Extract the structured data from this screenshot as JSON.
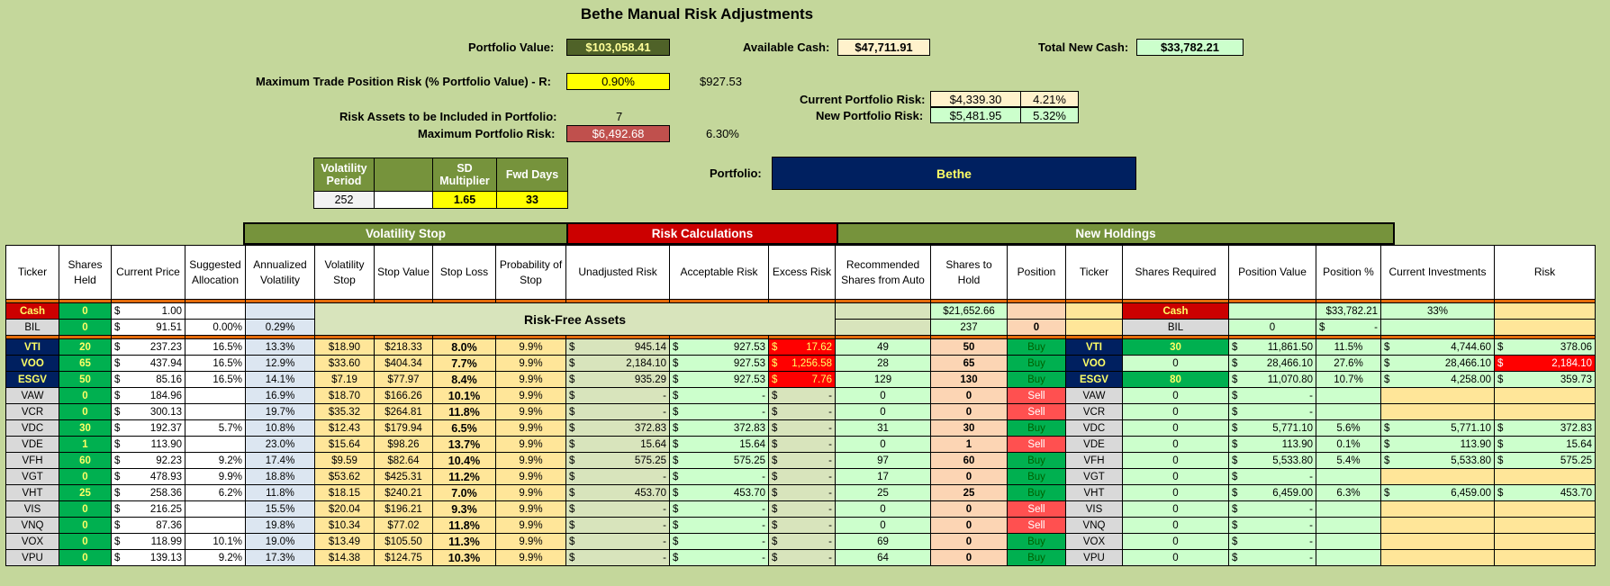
{
  "title": "Bethe Manual Risk Adjustments",
  "top": {
    "portfolio_value_label": "Portfolio Value:",
    "portfolio_value": "$103,058.41",
    "available_cash_label": "Available Cash:",
    "available_cash": "$47,711.91",
    "total_new_cash_label": "Total New Cash:",
    "total_new_cash": "$33,782.21",
    "max_trade_label": "Maximum Trade Position Risk (% Portfolio Value) - R:",
    "max_trade_pct": "0.90%",
    "max_trade_amount": "$927.53",
    "current_risk_label": "Current Portfolio Risk:",
    "current_risk_value": "$4,339.30",
    "current_risk_pct": "4.21%",
    "new_risk_label": "New Portfolio Risk:",
    "new_risk_value": "$5,481.95",
    "new_risk_pct": "5.32%",
    "risk_assets_label": "Risk Assets to be Included in Portfolio:",
    "risk_assets_count": "7",
    "max_portfolio_risk_label": "Maximum Portfolio Risk:",
    "max_portfolio_risk": "$6,492.68",
    "max_portfolio_risk_pct": "6.30%",
    "portfolio_label": "Portfolio:",
    "portfolio_name": "Bethe"
  },
  "params": {
    "h1": "Volatility Period",
    "h2": "",
    "h3": "SD Multiplier",
    "h4": "Fwd Days",
    "v1": "252",
    "v2": "",
    "v3": "1.65",
    "v4": "33"
  },
  "groups": {
    "volatility_stop": "Volatility Stop",
    "risk_calculations": "Risk Calculations",
    "new_holdings": "New Holdings"
  },
  "headers": [
    "Ticker",
    "Shares Held",
    "Current Price",
    "Suggested Allocation",
    "Annualized Volatility",
    "Volatility Stop",
    "Stop Value",
    "Stop Loss",
    "Probability of Stop",
    "Unadjusted Risk",
    "Acceptable Risk",
    "Excess Risk",
    "Recommended Shares from Auto",
    "Shares to Hold",
    "Position",
    "Ticker",
    "Shares Required",
    "Position Value",
    "Position %",
    "Current Investments",
    "Risk"
  ],
  "risk_free_label": "Risk-Free Assets",
  "cash_row": {
    "ticker": "Cash",
    "held": "0",
    "price": "1.00",
    "rec": "$21,652.66",
    "ticker2": "Cash",
    "pos_value": "$33,782.21",
    "pos_pct": "33%"
  },
  "bil_row": {
    "ticker": "BIL",
    "held": "0",
    "price": "91.51",
    "alloc": "0.00%",
    "vol": "0.29%",
    "rec": "237",
    "hold": "0",
    "ticker2": "BIL",
    "req": "0",
    "pos_value": "-"
  },
  "rows": [
    {
      "t": "VTI",
      "held": "20",
      "price": "237.23",
      "alloc": "16.5%",
      "vol": "13.3%",
      "vstop": "$18.90",
      "sval": "$218.33",
      "sloss": "8.0%",
      "prob": "9.9%",
      "unadj": "945.14",
      "acc": "927.53",
      "excess": "17.62",
      "rec": "49",
      "hold": "50",
      "pos": "Buy",
      "req": "30",
      "pval": "11,861.50",
      "ppct": "11.5%",
      "cur": "4,744.60",
      "risk": "378.06"
    },
    {
      "t": "VOO",
      "held": "65",
      "price": "437.94",
      "alloc": "16.5%",
      "vol": "12.9%",
      "vstop": "$33.60",
      "sval": "$404.34",
      "sloss": "7.7%",
      "prob": "9.9%",
      "unadj": "2,184.10",
      "acc": "927.53",
      "excess": "1,256.58",
      "rec": "28",
      "hold": "65",
      "pos": "Buy",
      "req": "0",
      "pval": "28,466.10",
      "ppct": "27.6%",
      "cur": "28,466.10",
      "risk": "2,184.10"
    },
    {
      "t": "ESGV",
      "held": "50",
      "price": "85.16",
      "alloc": "16.5%",
      "vol": "14.1%",
      "vstop": "$7.19",
      "sval": "$77.97",
      "sloss": "8.4%",
      "prob": "9.9%",
      "unadj": "935.29",
      "acc": "927.53",
      "excess": "7.76",
      "rec": "129",
      "hold": "130",
      "pos": "Buy",
      "req": "80",
      "pval": "11,070.80",
      "ppct": "10.7%",
      "cur": "4,258.00",
      "risk": "359.73"
    },
    {
      "t": "VAW",
      "held": "0",
      "price": "184.96",
      "alloc": "",
      "vol": "16.9%",
      "vstop": "$18.70",
      "sval": "$166.26",
      "sloss": "10.1%",
      "prob": "9.9%",
      "unadj": "-",
      "acc": "-",
      "excess": "-",
      "rec": "0",
      "hold": "0",
      "pos": "Sell",
      "req": "0",
      "pval": "-",
      "ppct": "",
      "cur": "",
      "risk": ""
    },
    {
      "t": "VCR",
      "held": "0",
      "price": "300.13",
      "alloc": "",
      "vol": "19.7%",
      "vstop": "$35.32",
      "sval": "$264.81",
      "sloss": "11.8%",
      "prob": "9.9%",
      "unadj": "-",
      "acc": "-",
      "excess": "-",
      "rec": "0",
      "hold": "0",
      "pos": "Sell",
      "req": "0",
      "pval": "-",
      "ppct": "",
      "cur": "",
      "risk": ""
    },
    {
      "t": "VDC",
      "held": "30",
      "price": "192.37",
      "alloc": "5.7%",
      "vol": "10.8%",
      "vstop": "$12.43",
      "sval": "$179.94",
      "sloss": "6.5%",
      "prob": "9.9%",
      "unadj": "372.83",
      "acc": "372.83",
      "excess": "-",
      "rec": "31",
      "hold": "30",
      "pos": "Buy",
      "req": "0",
      "pval": "5,771.10",
      "ppct": "5.6%",
      "cur": "5,771.10",
      "risk": "372.83"
    },
    {
      "t": "VDE",
      "held": "1",
      "price": "113.90",
      "alloc": "",
      "vol": "23.0%",
      "vstop": "$15.64",
      "sval": "$98.26",
      "sloss": "13.7%",
      "prob": "9.9%",
      "unadj": "15.64",
      "acc": "15.64",
      "excess": "-",
      "rec": "0",
      "hold": "1",
      "pos": "Sell",
      "req": "0",
      "pval": "113.90",
      "ppct": "0.1%",
      "cur": "113.90",
      "risk": "15.64"
    },
    {
      "t": "VFH",
      "held": "60",
      "price": "92.23",
      "alloc": "9.2%",
      "vol": "17.4%",
      "vstop": "$9.59",
      "sval": "$82.64",
      "sloss": "10.4%",
      "prob": "9.9%",
      "unadj": "575.25",
      "acc": "575.25",
      "excess": "-",
      "rec": "97",
      "hold": "60",
      "pos": "Buy",
      "req": "0",
      "pval": "5,533.80",
      "ppct": "5.4%",
      "cur": "5,533.80",
      "risk": "575.25"
    },
    {
      "t": "VGT",
      "held": "0",
      "price": "478.93",
      "alloc": "9.9%",
      "vol": "18.8%",
      "vstop": "$53.62",
      "sval": "$425.31",
      "sloss": "11.2%",
      "prob": "9.9%",
      "unadj": "-",
      "acc": "-",
      "excess": "-",
      "rec": "17",
      "hold": "0",
      "pos": "Buy",
      "req": "0",
      "pval": "-",
      "ppct": "",
      "cur": "",
      "risk": ""
    },
    {
      "t": "VHT",
      "held": "25",
      "price": "258.36",
      "alloc": "6.2%",
      "vol": "11.8%",
      "vstop": "$18.15",
      "sval": "$240.21",
      "sloss": "7.0%",
      "prob": "9.9%",
      "unadj": "453.70",
      "acc": "453.70",
      "excess": "-",
      "rec": "25",
      "hold": "25",
      "pos": "Buy",
      "req": "0",
      "pval": "6,459.00",
      "ppct": "6.3%",
      "cur": "6,459.00",
      "risk": "453.70"
    },
    {
      "t": "VIS",
      "held": "0",
      "price": "216.25",
      "alloc": "",
      "vol": "15.5%",
      "vstop": "$20.04",
      "sval": "$196.21",
      "sloss": "9.3%",
      "prob": "9.9%",
      "unadj": "-",
      "acc": "-",
      "excess": "-",
      "rec": "0",
      "hold": "0",
      "pos": "Sell",
      "req": "0",
      "pval": "-",
      "ppct": "",
      "cur": "",
      "risk": ""
    },
    {
      "t": "VNQ",
      "held": "0",
      "price": "87.36",
      "alloc": "",
      "vol": "19.8%",
      "vstop": "$10.34",
      "sval": "$77.02",
      "sloss": "11.8%",
      "prob": "9.9%",
      "unadj": "-",
      "acc": "-",
      "excess": "-",
      "rec": "0",
      "hold": "0",
      "pos": "Sell",
      "req": "0",
      "pval": "-",
      "ppct": "",
      "cur": "",
      "risk": ""
    },
    {
      "t": "VOX",
      "held": "0",
      "price": "118.99",
      "alloc": "10.1%",
      "vol": "19.0%",
      "vstop": "$13.49",
      "sval": "$105.50",
      "sloss": "11.3%",
      "prob": "9.9%",
      "unadj": "-",
      "acc": "-",
      "excess": "-",
      "rec": "69",
      "hold": "0",
      "pos": "Buy",
      "req": "0",
      "pval": "-",
      "ppct": "",
      "cur": "",
      "risk": ""
    },
    {
      "t": "VPU",
      "held": "0",
      "price": "139.13",
      "alloc": "9.2%",
      "vol": "17.3%",
      "vstop": "$14.38",
      "sval": "$124.75",
      "sloss": "10.3%",
      "prob": "9.9%",
      "unadj": "-",
      "acc": "-",
      "excess": "-",
      "rec": "64",
      "hold": "0",
      "pos": "Buy",
      "req": "0",
      "pval": "-",
      "ppct": "",
      "cur": "",
      "risk": ""
    }
  ],
  "colors": {
    "sheet_bg": "#c4d79b",
    "dark_green": "#76933c",
    "buy_green": "#00b050",
    "sell_red": "#ff5050",
    "navy": "#002060",
    "excess_red": "#ff0000"
  }
}
